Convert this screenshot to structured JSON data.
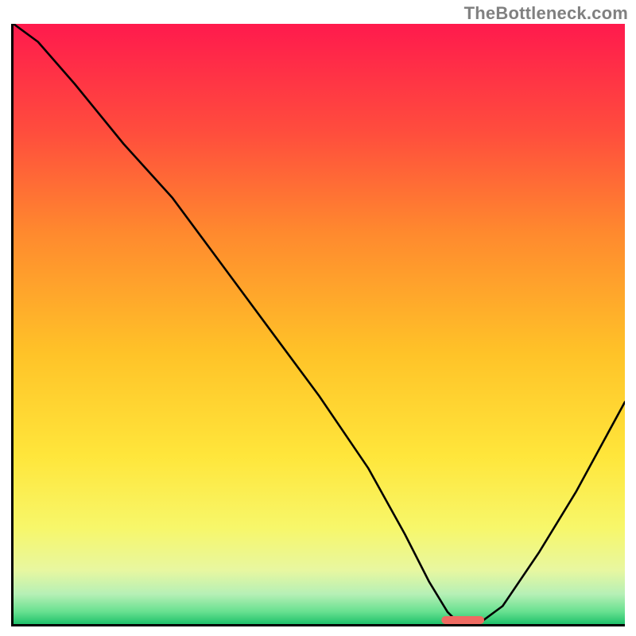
{
  "watermark": "TheBottleneck.com",
  "chart_data": {
    "type": "line",
    "title": "",
    "xlabel": "",
    "ylabel": "",
    "xlim": [
      0,
      100
    ],
    "ylim": [
      0,
      100
    ],
    "grid": false,
    "legend": false,
    "notes": "Single black curve over a vertical rainbow gradient background (red top → green bottom). Curve descends from top-left, dips to near 0 around x≈73, then rises again toward the right. A short coral-red rounded marker sits on the x-axis at the curve minimum.",
    "gradient_stops": [
      {
        "pct": 0,
        "color": "#ff1a4d"
      },
      {
        "pct": 18,
        "color": "#ff4d3d"
      },
      {
        "pct": 35,
        "color": "#ff8a2e"
      },
      {
        "pct": 55,
        "color": "#ffc328"
      },
      {
        "pct": 72,
        "color": "#ffe63b"
      },
      {
        "pct": 84,
        "color": "#f7f76a"
      },
      {
        "pct": 91,
        "color": "#e8f7a0"
      },
      {
        "pct": 95,
        "color": "#b6f0b6"
      },
      {
        "pct": 98,
        "color": "#66e08f"
      },
      {
        "pct": 100,
        "color": "#1fc06a"
      }
    ],
    "series": [
      {
        "name": "curve",
        "x": [
          0,
          4,
          10,
          18,
          26,
          34,
          42,
          50,
          58,
          64,
          68,
          71,
          73,
          76,
          80,
          86,
          92,
          100
        ],
        "y": [
          100,
          97,
          90,
          80,
          71,
          60,
          49,
          38,
          26,
          15,
          7,
          2,
          0,
          0,
          3,
          12,
          22,
          37
        ]
      }
    ],
    "marker": {
      "x_start": 70,
      "x_end": 77,
      "y": 0
    }
  }
}
